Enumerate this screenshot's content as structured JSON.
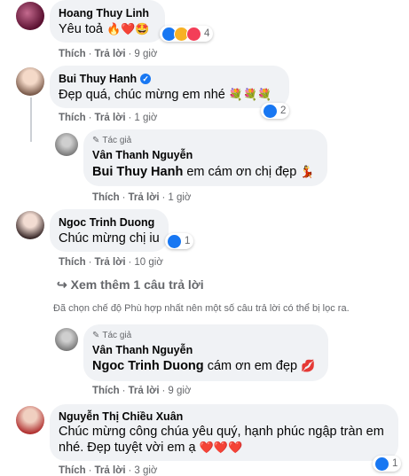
{
  "comments": [
    {
      "name": "Hoang Thuy Linh",
      "text": "Yêu toả",
      "emojis": "🔥❤️🤩",
      "reaction_count": "4",
      "like": "Thích",
      "reply": "Trả lời",
      "time": "9 giờ"
    },
    {
      "name": "Bui Thuy Hanh",
      "text": "Đẹp quá, chúc mừng em nhé",
      "emojis": "💐💐💐",
      "reaction_count": "2",
      "like": "Thích",
      "reply": "Trả lời",
      "time": "1 giờ"
    },
    {
      "author_tag": "Tác giả",
      "name": "Vân Thanh Nguyễn",
      "mention": "Bui Thuy Hanh",
      "text": "em cám ơn chị đẹp",
      "emojis": "💃",
      "like": "Thích",
      "reply": "Trả lời",
      "time": "1 giờ"
    },
    {
      "name": "Ngoc Trinh Duong",
      "text": "Chúc mừng chị iu",
      "reaction_count": "1",
      "like": "Thích",
      "reply": "Trả lời",
      "time": "10 giờ"
    },
    {
      "author_tag": "Tác giả",
      "name": "Vân Thanh Nguyễn",
      "mention": "Ngoc Trinh Duong",
      "text": "cám ơn em đẹp",
      "emojis": "💋",
      "like": "Thích",
      "reply": "Trả lời",
      "time": "9 giờ"
    },
    {
      "name": "Nguyễn Thị Chiều Xuân",
      "text_line1": "Chúc mừng công chúa yêu quý, hạnh phúc ngập tràn em",
      "text_line2": "nhé. Đẹp tuyệt vời em ạ",
      "emojis": "❤️❤️❤️",
      "reaction_count": "1",
      "like": "Thích",
      "reply": "Trả lời",
      "time": "3 giờ"
    }
  ],
  "see_more": "↪ Xem thêm 1 câu trả lời",
  "filter_notice": "Đã chọn chế độ Phù hợp nhất nên một số câu trả lời có thể bị lọc ra.",
  "colors": {
    "bubble": "#f0f2f5",
    "secondary_text": "#65676b",
    "verified": "#1877f2",
    "like_blue": "#1877f2",
    "love_red": "#f33e58",
    "haha_yellow": "#f7b125"
  }
}
